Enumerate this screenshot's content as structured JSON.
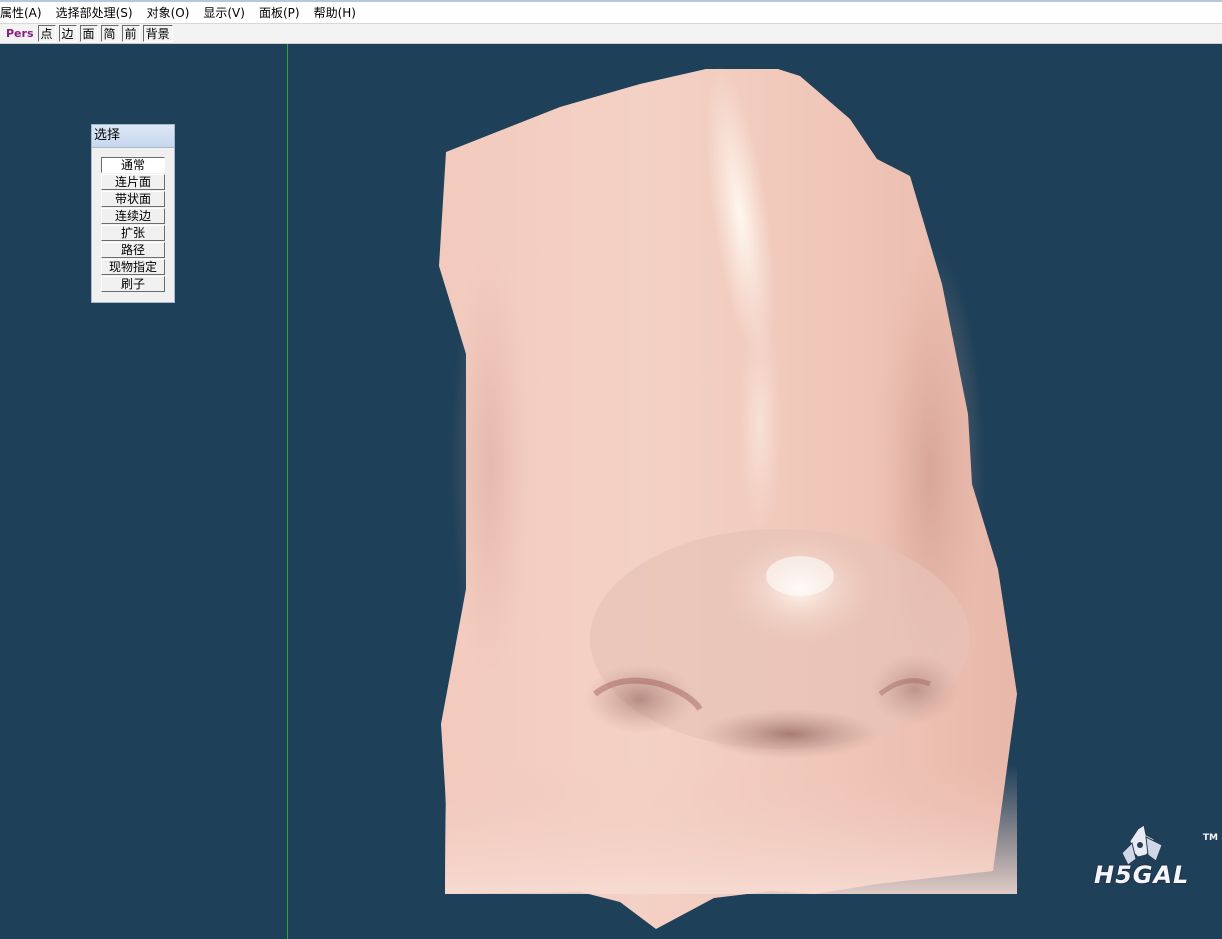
{
  "menubar": {
    "items": [
      {
        "label": "属性(A)"
      },
      {
        "label": "选择部处理(S)"
      },
      {
        "label": "对象(O)"
      },
      {
        "label": "显示(V)"
      },
      {
        "label": "面板(P)"
      },
      {
        "label": "帮助(H)"
      }
    ]
  },
  "toolbar": {
    "view_label": "Pers",
    "buttons": [
      {
        "label": "点"
      },
      {
        "label": "边"
      },
      {
        "label": "面"
      },
      {
        "label": "简"
      },
      {
        "label": "前"
      },
      {
        "label": "背景"
      }
    ]
  },
  "select_panel": {
    "title": "选择",
    "options": [
      {
        "label": "通常",
        "active": true
      },
      {
        "label": "连片面"
      },
      {
        "label": "带状面"
      },
      {
        "label": "连续边"
      },
      {
        "label": "扩张"
      },
      {
        "label": "路径"
      },
      {
        "label": "现物指定"
      },
      {
        "label": "刷子"
      }
    ]
  },
  "watermark": {
    "text": "H5GAL",
    "tm": "TM"
  },
  "colors": {
    "viewport_bg": "#1e4059",
    "axis_line": "#2ea832",
    "skin_base": "#f2cbbd",
    "skin_highlight": "#fff3ea",
    "skin_shadow": "#b07f77",
    "view_label": "#8a1c82"
  }
}
